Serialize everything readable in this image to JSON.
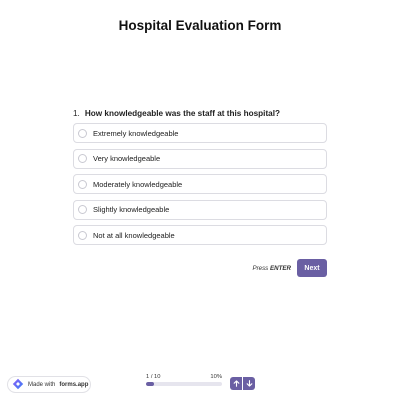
{
  "form": {
    "title": "Hospital Evaluation Form"
  },
  "question": {
    "number": "1.",
    "text": "How knowledgeable was the staff at this hospital?",
    "options": [
      "Extremely knowledgeable",
      "Very knowledgeable",
      "Moderately knowledgeable",
      "Slightly knowledgeable",
      "Not at all knowledgeable"
    ]
  },
  "actions": {
    "hint_prefix": "Press",
    "hint_key": "ENTER",
    "next_label": "Next"
  },
  "footer": {
    "badge_prefix": "Made with",
    "badge_brand": "forms.app",
    "badge_icon": "forms-app-logo-icon",
    "progress_count": "1 / 10",
    "progress_percent_label": "10%",
    "progress_fraction": 0.1,
    "nav_up_icon": "arrow-up-icon",
    "nav_down_icon": "arrow-down-icon"
  },
  "colors": {
    "accent": "#6a5fa3",
    "track": "#e6e5ee",
    "option_border": "#dcdce2",
    "logo_gradient_start": "#8a5cf6",
    "logo_gradient_end": "#3b82f6"
  }
}
